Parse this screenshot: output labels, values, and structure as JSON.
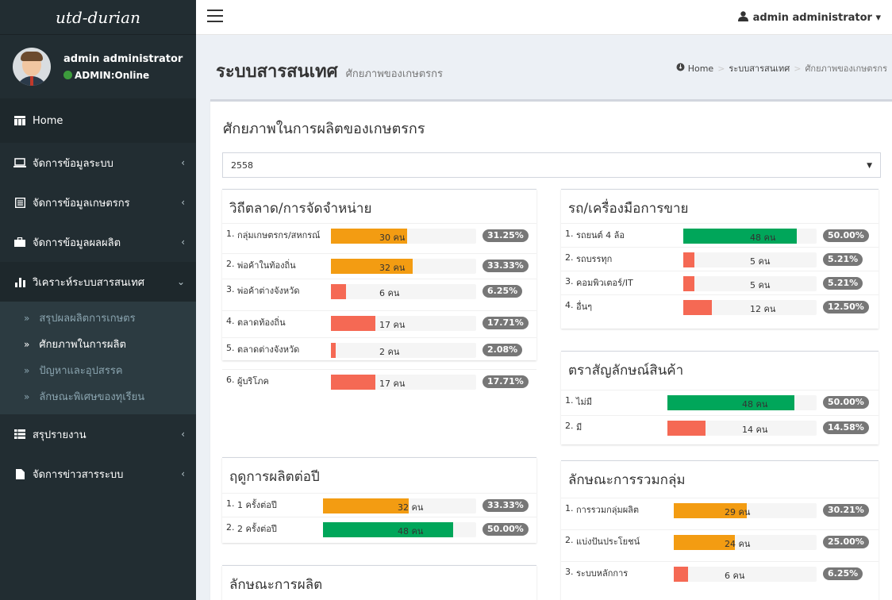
{
  "app": {
    "logo": "utd-durian"
  },
  "user": {
    "name": "admin administrator",
    "status": "ADMIN:Online"
  },
  "topbar": {
    "user_label": "admin administrator ▾"
  },
  "sidebar": {
    "items": [
      {
        "label": "Home"
      },
      {
        "label": "จัดการข้อมูลระบบ"
      },
      {
        "label": "จัดการข้อมูลเกษตรกร"
      },
      {
        "label": "จัดการข้อมูลผลผลิต"
      },
      {
        "label": "วิเคราะห์ระบบสารสนเทศ"
      },
      {
        "label": "สรุปรายงาน"
      },
      {
        "label": "จัดการข่าวสารระบบ"
      }
    ],
    "submenu": [
      {
        "label": "สรุปผลผลิตการเกษตร"
      },
      {
        "label": "ศักยภาพในการผลิต"
      },
      {
        "label": "ปัญหาและอุปสรรค"
      },
      {
        "label": "ลักษณะพิเศษของทุเรียน"
      }
    ]
  },
  "header": {
    "title": "ระบบสารสนเทศ",
    "subtitle": "ศักยภาพของเกษตรกร"
  },
  "breadcrumb": [
    "Home",
    "ระบบสารสนเทศ",
    "ศักยภาพของเกษตรกร"
  ],
  "main": {
    "title": "ศักยภาพในการผลิตของเกษตรกร",
    "year": "2558"
  },
  "colors": {
    "orange": "#f39c12",
    "green": "#00a65a",
    "red": "#f56954",
    "badge": "#777777"
  },
  "panels": {
    "marketing": {
      "title": "วิถีตลาด/การจัดจำหน่าย",
      "rows": [
        {
          "idx": "1.",
          "label": "กลุ่มเกษตรกร/สหกรณ์",
          "count": "30 คน",
          "pct": "31.25%",
          "fill": 0.31,
          "color": "orange"
        },
        {
          "idx": "2.",
          "label": "พ่อค้าในท้องถิ่น",
          "count": "32 คน",
          "pct": "33.33%",
          "fill": 0.33,
          "color": "orange"
        },
        {
          "idx": "3.",
          "label": "พ่อค้าต่างจังหวัด",
          "count": "6 คน",
          "pct": "6.25%",
          "fill": 0.06,
          "color": "red"
        },
        {
          "idx": "4.",
          "label": "ตลาดท้องถิ่น",
          "count": "17 คน",
          "pct": "17.71%",
          "fill": 0.18,
          "color": "red"
        },
        {
          "idx": "5.",
          "label": "ตลาดต่างจังหวัด",
          "count": "2 คน",
          "pct": "2.08%",
          "fill": 0.02,
          "color": "red"
        },
        {
          "idx": "6.",
          "label": "ผู้บริโภค",
          "count": "17 คน",
          "pct": "17.71%",
          "fill": 0.18,
          "color": "red"
        }
      ]
    },
    "vehicles": {
      "title": "รถ/เครื่องมือการขาย",
      "rows": [
        {
          "idx": "1.",
          "label": "รถยนต์ 4 ล้อ",
          "count": "48 คน",
          "pct": "50.00%",
          "fill": 0.5,
          "color": "green"
        },
        {
          "idx": "2.",
          "label": "รถบรรทุก",
          "count": "5 คน",
          "pct": "5.21%",
          "fill": 0.05,
          "color": "red"
        },
        {
          "idx": "3.",
          "label": "คอมพิวเตอร์/IT",
          "count": "5 คน",
          "pct": "5.21%",
          "fill": 0.05,
          "color": "red"
        },
        {
          "idx": "4.",
          "label": "อื่นๆ",
          "count": "12 คน",
          "pct": "12.50%",
          "fill": 0.125,
          "color": "red"
        }
      ]
    },
    "brand": {
      "title": "ตราสัญลักษณ์สินค้า",
      "rows": [
        {
          "idx": "1.",
          "label": "ไม่มี",
          "count": "48 คน",
          "pct": "50.00%",
          "fill": 0.5,
          "color": "green"
        },
        {
          "idx": "2.",
          "label": "มี",
          "count": "14 คน",
          "pct": "14.58%",
          "fill": 0.15,
          "color": "red"
        }
      ]
    },
    "season": {
      "title": "ฤดูการผลิตต่อปี",
      "rows": [
        {
          "idx": "1.",
          "label": "1 ครั้งต่อปี",
          "count": "32 คน",
          "pct": "33.33%",
          "fill": 0.33,
          "color": "orange"
        },
        {
          "idx": "2.",
          "label": "2 ครั้งต่อปี",
          "count": "48 คน",
          "pct": "50.00%",
          "fill": 0.5,
          "color": "green"
        }
      ]
    },
    "production": {
      "title": "ลักษณะการผลิต",
      "rows": []
    },
    "grouping": {
      "title": "ลักษณะการรวมกลุ่ม",
      "rows": [
        {
          "idx": "1.",
          "label": "การรวมกลุ่มผลิต",
          "count": "29 คน",
          "pct": "30.21%",
          "fill": 0.3,
          "color": "orange"
        },
        {
          "idx": "2.",
          "label": "แบ่งปันประโยชน์",
          "count": "24 คน",
          "pct": "25.00%",
          "fill": 0.25,
          "color": "orange"
        },
        {
          "idx": "3.",
          "label": "ระบบหลักการ",
          "count": "6 คน",
          "pct": "6.25%",
          "fill": 0.06,
          "color": "red"
        }
      ]
    }
  }
}
